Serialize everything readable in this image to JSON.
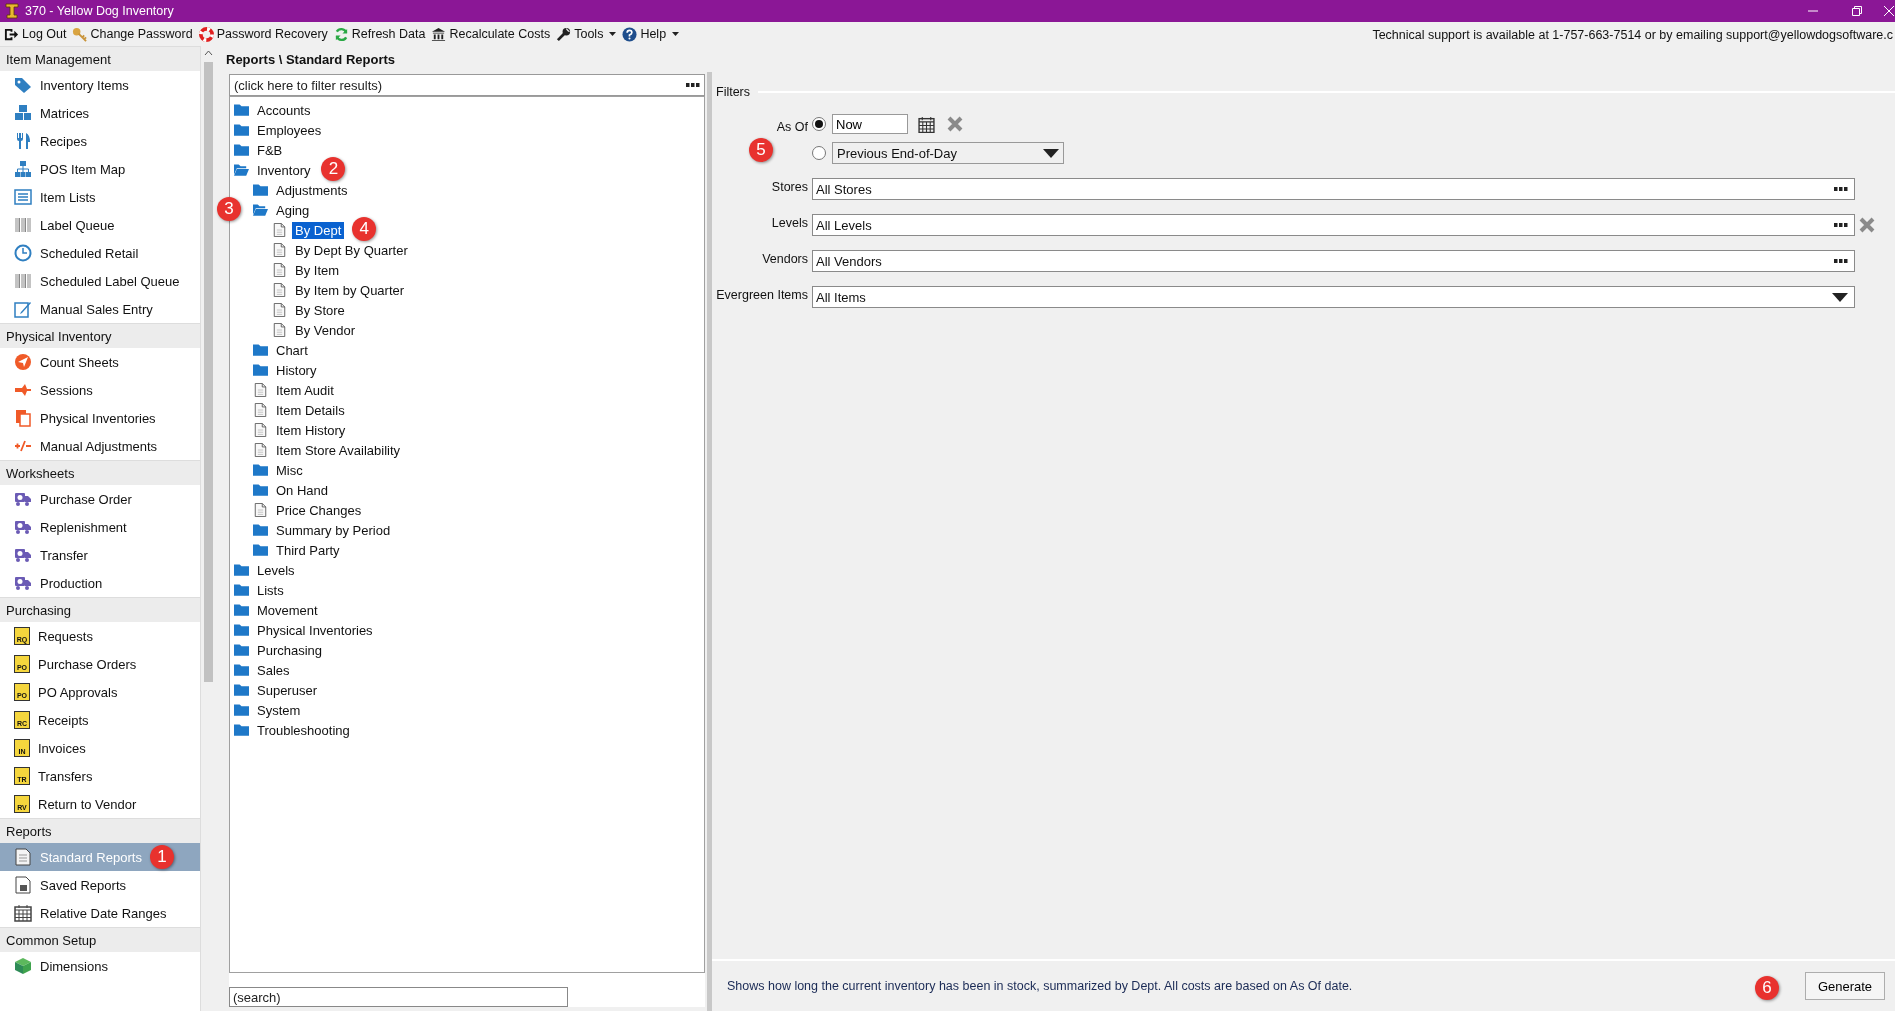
{
  "window": {
    "title": "370  - Yellow Dog Inventory"
  },
  "toolbar": [
    {
      "label": "Log Out",
      "menu": false
    },
    {
      "label": "Change Password",
      "menu": false
    },
    {
      "label": "Password Recovery",
      "menu": false
    },
    {
      "label": "Refresh Data",
      "menu": false
    },
    {
      "label": "Recalculate Costs",
      "menu": false
    },
    {
      "label": "Tools",
      "menu": true
    },
    {
      "label": "Help",
      "menu": true
    }
  ],
  "support_text": "Technical support is available at 1-757-663-7514 or by emailing support@yellowdogsoftware.c",
  "sidebar": {
    "groups": [
      {
        "title": "Item Management",
        "items": [
          {
            "label": "Inventory Items",
            "selected": false
          },
          {
            "label": "Matrices",
            "selected": false
          },
          {
            "label": "Recipes",
            "selected": false
          },
          {
            "label": "POS Item Map",
            "selected": false
          },
          {
            "label": "Item Lists",
            "selected": false
          },
          {
            "label": "Label Queue",
            "selected": false
          },
          {
            "label": "Scheduled Retail",
            "selected": false
          },
          {
            "label": "Scheduled Label Queue",
            "selected": false
          },
          {
            "label": "Manual Sales Entry",
            "selected": false
          }
        ]
      },
      {
        "title": "Physical Inventory",
        "items": [
          {
            "label": "Count Sheets",
            "selected": false
          },
          {
            "label": "Sessions",
            "selected": false
          },
          {
            "label": "Physical Inventories",
            "selected": false
          },
          {
            "label": "Manual Adjustments",
            "selected": false
          }
        ]
      },
      {
        "title": "Worksheets",
        "items": [
          {
            "label": "Purchase Order",
            "selected": false
          },
          {
            "label": "Replenishment",
            "selected": false
          },
          {
            "label": "Transfer",
            "selected": false
          },
          {
            "label": "Production",
            "selected": false
          }
        ]
      },
      {
        "title": "Purchasing",
        "items": [
          {
            "label": "Requests",
            "badge": "RQ",
            "selected": false
          },
          {
            "label": "Purchase Orders",
            "badge": "PO",
            "selected": false
          },
          {
            "label": "PO Approvals",
            "badge": "PO",
            "selected": false
          },
          {
            "label": "Receipts",
            "badge": "RC",
            "selected": false
          },
          {
            "label": "Invoices",
            "badge": "IN",
            "selected": false
          },
          {
            "label": "Transfers",
            "badge": "TR",
            "selected": false
          },
          {
            "label": "Return to Vendor",
            "badge": "RV",
            "selected": false
          }
        ]
      },
      {
        "title": "Reports",
        "items": [
          {
            "label": "Standard Reports",
            "selected": true,
            "marker": "1"
          },
          {
            "label": "Saved Reports",
            "selected": false
          },
          {
            "label": "Relative Date Ranges",
            "selected": false
          }
        ]
      },
      {
        "title": "Common Setup",
        "items": [
          {
            "label": "Dimensions",
            "selected": false
          }
        ]
      }
    ]
  },
  "breadcrumb": "Reports \\ Standard Reports",
  "tree": {
    "filter": {
      "placeholder": "(click here to filter results)"
    },
    "nodes": [
      {
        "label": "Accounts",
        "kind": "folder",
        "expanded": false,
        "selected": false
      },
      {
        "label": "Employees",
        "kind": "folder",
        "expanded": false,
        "selected": false
      },
      {
        "label": "F&B",
        "kind": "folder",
        "expanded": false,
        "selected": false
      },
      {
        "label": "Inventory",
        "kind": "folder",
        "expanded": true,
        "selected": false,
        "marker": "2",
        "children": [
          {
            "label": "Adjustments",
            "kind": "folder",
            "expanded": false,
            "selected": false
          },
          {
            "label": "Aging",
            "kind": "folder",
            "expanded": true,
            "selected": false,
            "marker_before": "3",
            "children": [
              {
                "label": "By Dept",
                "kind": "report",
                "selected": true,
                "marker": "4"
              },
              {
                "label": "By Dept By Quarter",
                "kind": "report",
                "selected": false
              },
              {
                "label": "By Item",
                "kind": "report",
                "selected": false
              },
              {
                "label": "By Item by Quarter",
                "kind": "report",
                "selected": false
              },
              {
                "label": "By Store",
                "kind": "report",
                "selected": false
              },
              {
                "label": "By Vendor",
                "kind": "report",
                "selected": false
              }
            ]
          },
          {
            "label": "Chart",
            "kind": "folder",
            "expanded": false,
            "selected": false
          },
          {
            "label": "History",
            "kind": "folder",
            "expanded": false,
            "selected": false
          },
          {
            "label": "Item Audit",
            "kind": "report",
            "selected": false
          },
          {
            "label": "Item Details",
            "kind": "report",
            "selected": false
          },
          {
            "label": "Item History",
            "kind": "report",
            "selected": false
          },
          {
            "label": "Item Store Availability",
            "kind": "report",
            "selected": false
          },
          {
            "label": "Misc",
            "kind": "folder",
            "expanded": false,
            "selected": false
          },
          {
            "label": "On Hand",
            "kind": "folder",
            "expanded": false,
            "selected": false
          },
          {
            "label": "Price Changes",
            "kind": "report",
            "selected": false
          },
          {
            "label": "Summary by Period",
            "kind": "folder",
            "expanded": false,
            "selected": false
          },
          {
            "label": "Third Party",
            "kind": "folder",
            "expanded": false,
            "selected": false
          }
        ]
      },
      {
        "label": "Levels",
        "kind": "folder",
        "expanded": false,
        "selected": false
      },
      {
        "label": "Lists",
        "kind": "folder",
        "expanded": false,
        "selected": false
      },
      {
        "label": "Movement",
        "kind": "folder",
        "expanded": false,
        "selected": false
      },
      {
        "label": "Physical Inventories",
        "kind": "folder",
        "expanded": false,
        "selected": false
      },
      {
        "label": "Purchasing",
        "kind": "folder",
        "expanded": false,
        "selected": false
      },
      {
        "label": "Sales",
        "kind": "folder",
        "expanded": false,
        "selected": false
      },
      {
        "label": "Superuser",
        "kind": "folder",
        "expanded": false,
        "selected": false
      },
      {
        "label": "System",
        "kind": "folder",
        "expanded": false,
        "selected": false
      },
      {
        "label": "Troubleshooting",
        "kind": "folder",
        "expanded": false,
        "selected": false
      }
    ],
    "search": {
      "placeholder": "(search)"
    }
  },
  "filters": {
    "title": "Filters",
    "as_of": {
      "label": "As Of",
      "options": [
        {
          "selected": true,
          "value": "Now",
          "kind": "date"
        },
        {
          "selected": false,
          "value": "Previous End-of-Day",
          "kind": "dropdown",
          "marker": "5"
        }
      ]
    },
    "fields": [
      {
        "label": "Stores",
        "value": "All Stores",
        "kind": "browse",
        "clearable": false
      },
      {
        "label": "Levels",
        "value": "All Levels",
        "kind": "browse",
        "clearable": true
      },
      {
        "label": "Vendors",
        "value": "All Vendors",
        "kind": "browse",
        "clearable": false
      },
      {
        "label": "Evergreen Items",
        "value": "All Items",
        "kind": "dropdown",
        "clearable": false
      }
    ]
  },
  "description": "Shows how long the current inventory has been in stock, summarized by Dept. All costs are based on As Of date.",
  "generate": {
    "label": "Generate",
    "marker": "6"
  }
}
